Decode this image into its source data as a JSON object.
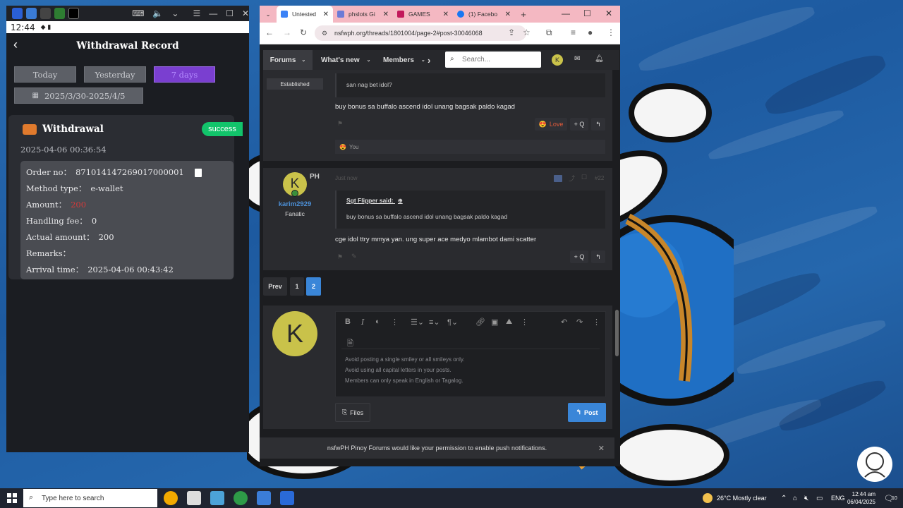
{
  "phone": {
    "status_time": "12:44",
    "header_title": "Withdrawal Record",
    "filters": {
      "today": "Today",
      "yesterday": "Yesterday",
      "active": "7 days",
      "date_range": "2025/3/30-2025/4/5"
    },
    "card": {
      "title": "Withdrawal",
      "status": "success",
      "timestamp": "2025-04-06 00:36:54",
      "order_label": "Order no：",
      "order_value": "871014147269017000001",
      "method_label": "Method type：",
      "method_value": "e-wallet",
      "amount_label": "Amount：",
      "amount_value": "200",
      "fee_label": "Handling fee：",
      "fee_value": "0",
      "actual_label": "Actual amount：",
      "actual_value": "200",
      "remarks_label": "Remarks：",
      "arrival_label": "Arrival time：",
      "arrival_value": "2025-04-06 00:43:42"
    }
  },
  "browser": {
    "tabs": [
      {
        "label": "Untested",
        "color": "#3b82f6"
      },
      {
        "label": "phslots Gi",
        "color": "#6b7bd6"
      },
      {
        "label": "GAMES",
        "color": "#c2185b"
      },
      {
        "label": "(1) Facebo",
        "color": "#1877f2"
      }
    ],
    "url": "nsfwph.org/threads/1801004/page-2#post-30046068",
    "nav": {
      "forums": "Forums",
      "whats_new": "What's new",
      "members": "Members",
      "search_placeholder": "Search..."
    },
    "avatar_letter": "K",
    "post1": {
      "rank": "Established",
      "quote_text": "san nag bet idol?",
      "body": "buy bonus sa buffalo ascend idol unang bagsak paldo kagad",
      "love": "Love",
      "quote_btn": "+ Q",
      "reaction_you": "You"
    },
    "post2": {
      "avatar_letter": "K",
      "flag": "PH",
      "username": "karim2929",
      "rank": "Fanatic",
      "date": "Just now",
      "quote_author": "Sgt Flipper said:",
      "quote_text": "buy bonus sa buffalo ascend idol unang bagsak paldo kagad",
      "body": "cge idol ttry mmya yan. ung super ace medyo mlambot dami scatter",
      "quote_btn": "+ Q"
    },
    "pagination": {
      "prev": "Prev",
      "p1": "1",
      "p2": "2"
    },
    "editor": {
      "avatar_letter": "K",
      "hints": [
        "Avoid posting a single smiley or all smileys only.",
        "Avoid using all capital letters in your posts.",
        "Members can only speak in English or Tagalog."
      ],
      "files": "Files",
      "post": "Post"
    },
    "notification": "nsfwPH Pinoy Forums would like your permission to enable push notifications."
  },
  "taskbar": {
    "search_placeholder": "Type here to search",
    "weather": "26°C  Mostly clear",
    "lang": "ENG",
    "time": "12:44 am",
    "date": "06/04/2025",
    "notif_count": "10"
  }
}
